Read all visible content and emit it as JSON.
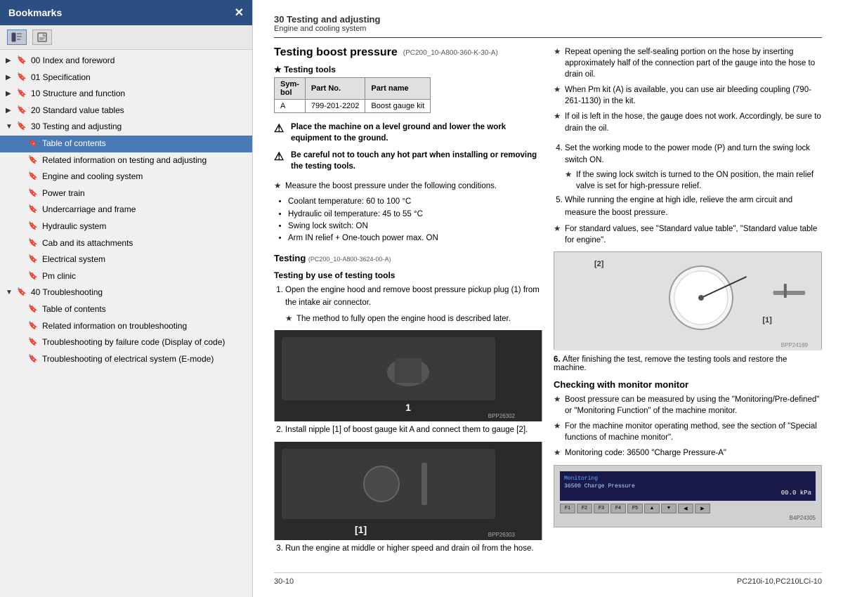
{
  "sidebar": {
    "title": "Bookmarks",
    "close_label": "✕",
    "toolbar": {
      "icon1": "☰",
      "icon2": "🔖"
    },
    "items": [
      {
        "id": "00",
        "label": "00 Index and foreword",
        "indent": 0,
        "expanded": false,
        "selected": false
      },
      {
        "id": "01",
        "label": "01 Specification",
        "indent": 0,
        "expanded": false,
        "selected": false
      },
      {
        "id": "10",
        "label": "10 Structure and function",
        "indent": 0,
        "expanded": false,
        "selected": false
      },
      {
        "id": "20",
        "label": "20 Standard value tables",
        "indent": 0,
        "expanded": false,
        "selected": false
      },
      {
        "id": "30",
        "label": "30 Testing and adjusting",
        "indent": 0,
        "expanded": true,
        "selected": false
      },
      {
        "id": "30-toc",
        "label": "Table of contents",
        "indent": 1,
        "expanded": false,
        "selected": true
      },
      {
        "id": "30-rel",
        "label": "Related information on testing and adjusting",
        "indent": 1,
        "expanded": false,
        "selected": false
      },
      {
        "id": "30-eng",
        "label": "Engine and cooling system",
        "indent": 1,
        "expanded": false,
        "selected": false
      },
      {
        "id": "30-pow",
        "label": "Power train",
        "indent": 1,
        "expanded": false,
        "selected": false
      },
      {
        "id": "30-und",
        "label": "Undercarriage and frame",
        "indent": 1,
        "expanded": false,
        "selected": false
      },
      {
        "id": "30-hyd",
        "label": "Hydraulic system",
        "indent": 1,
        "expanded": false,
        "selected": false
      },
      {
        "id": "30-cab",
        "label": "Cab and its attachments",
        "indent": 1,
        "expanded": false,
        "selected": false
      },
      {
        "id": "30-ele",
        "label": "Electrical system",
        "indent": 1,
        "expanded": false,
        "selected": false
      },
      {
        "id": "30-pm",
        "label": "Pm clinic",
        "indent": 1,
        "expanded": false,
        "selected": false
      },
      {
        "id": "40",
        "label": "40 Troubleshooting",
        "indent": 0,
        "expanded": true,
        "selected": false
      },
      {
        "id": "40-toc",
        "label": "Table of contents",
        "indent": 1,
        "expanded": false,
        "selected": false
      },
      {
        "id": "40-rel",
        "label": "Related information on troubleshooting",
        "indent": 1,
        "expanded": false,
        "selected": false
      },
      {
        "id": "40-fail",
        "label": "Troubleshooting by failure code (Display of code)",
        "indent": 1,
        "expanded": false,
        "selected": false
      },
      {
        "id": "40-elec",
        "label": "Troubleshooting of electrical system (E-mode)",
        "indent": 1,
        "expanded": true,
        "selected": false
      }
    ]
  },
  "main": {
    "header": {
      "title": "30 Testing and adjusting",
      "subtitle": "Engine and cooling system"
    },
    "section": {
      "title": "Testing boost pressure",
      "ref": "(PC200_10-A800-360-K-30-A)"
    },
    "testing_tools": {
      "header": "★ Testing tools",
      "table": {
        "columns": [
          "Symbol",
          "Part No.",
          "Part name"
        ],
        "rows": [
          [
            "A",
            "799-201-2202",
            "Boost gauge kit"
          ]
        ]
      }
    },
    "warnings": [
      "Place the machine on a level ground and lower the work equipment to the ground.",
      "Be careful not to touch any hot part when installing or removing the testing tools."
    ],
    "left_stars": [
      "Measure the boost pressure under the following conditions.",
      "Coolant temperature: 60 to 100 °C",
      "Hydraulic oil temperature: 45 to 55 °C",
      "Swing lock switch: ON",
      "Arm IN relief + One-touch power max. ON"
    ],
    "testing_subsection": {
      "title": "Testing",
      "ref": "(PC200_10-A800-3624-00-A)"
    },
    "testing_by_tools": {
      "title": "Testing by use of testing tools",
      "steps": [
        "Open the engine hood and remove boost pressure pickup plug (1) from the intake air connector.",
        "Install nipple [1] of boost gauge kit A and connect them to gauge [2].",
        "Run the engine at middle or higher speed and drain oil from the hose."
      ],
      "star1": "The method to fully open the engine hood is described later."
    },
    "right_stars": [
      "Repeat opening the self-sealing portion on the hose by inserting approximately half of the connection part of the gauge into the hose to drain oil.",
      "When Pm kit (A) is available, you can use air bleeding coupling (790-261-1130) in the kit.",
      "If oil is left in the hose, the gauge does not work. Accordingly, be sure to drain the oil."
    ],
    "numbered_steps_right": [
      "Set the working mode to the power mode (P) and turn the swing lock switch ON.",
      "If the swing lock switch is turned to the ON position, the main relief valve is set for high-pressure relief.",
      "While running the engine at high idle, relieve the arm circuit and measure the boost pressure."
    ],
    "stars_right2": [
      "For standard values, see \"Standard value table\", \"Standard value table for engine\"."
    ],
    "img1_caption": "BPP26302",
    "img2_caption": "BPP26303",
    "img3_caption": "BPP24189",
    "img3_labels": [
      "[2]",
      "[1]"
    ],
    "checking_monitor": {
      "title": "Checking with monitor monitor",
      "stars": [
        "Boost pressure can be measured by using the \"Monitoring/Pre-defined\" or \"Monitoring Function\" of the machine monitor.",
        "For the machine monitor operating method, see the section of \"Special functions of machine monitor\".",
        "Monitoring code: 36500 \"Charge Pressure-A\""
      ]
    },
    "after_test": {
      "step_num": "6.",
      "text": "After finishing the test, remove the testing tools and restore the machine."
    },
    "footer": {
      "page": "30-10",
      "model": "PC210i-10,PC210LCi-10"
    },
    "monitor_caption": "B4P24305"
  }
}
